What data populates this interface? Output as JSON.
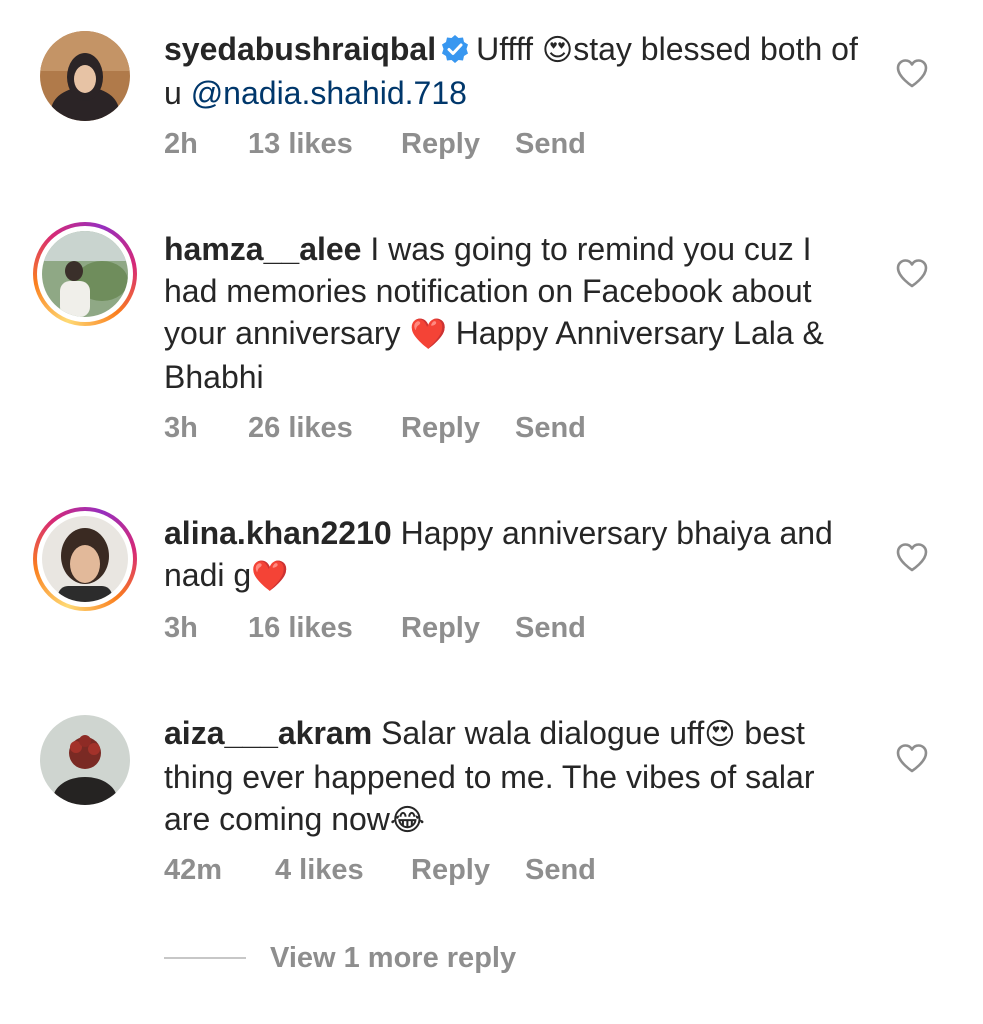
{
  "comments": [
    {
      "username": "syedabushraiqbal",
      "verified": true,
      "text_a": "Uffff ",
      "emoji_a": "😍",
      "text_b": "stay blessed both of u ",
      "mention": "@nadia.shahid.718",
      "time": "2h",
      "likes": "13 likes",
      "reply": "Reply",
      "send": "Send"
    },
    {
      "username": "hamza__alee",
      "text_a": " I was going to remind you cuz I had memories notification on Facebook about your anniversary ",
      "emoji_a": "❤️",
      "text_b": " Happy Anniversary Lala & Bhabhi",
      "time": "3h",
      "likes": "26 likes",
      "reply": "Reply",
      "send": "Send"
    },
    {
      "username": "alina.khan2210",
      "text_a": " Happy anniversary bhaiya and nadi g",
      "emoji_a": "❤️",
      "time": "3h",
      "likes": "16 likes",
      "reply": "Reply",
      "send": "Send"
    },
    {
      "username": "aiza___akram",
      "text_a": " Salar wala dialogue uff",
      "emoji_a": "😍",
      "text_b": " best thing ever happened to me. The vibes of salar are coming now",
      "emoji_b": "😂",
      "time": "42m",
      "likes": "4 likes",
      "reply": "Reply",
      "send": "Send"
    }
  ],
  "view_more": "View 1 more reply",
  "colors": {
    "text": "#262626",
    "meta": "#8e8e8e",
    "mention": "#00376b",
    "verified": "#3897f0"
  }
}
